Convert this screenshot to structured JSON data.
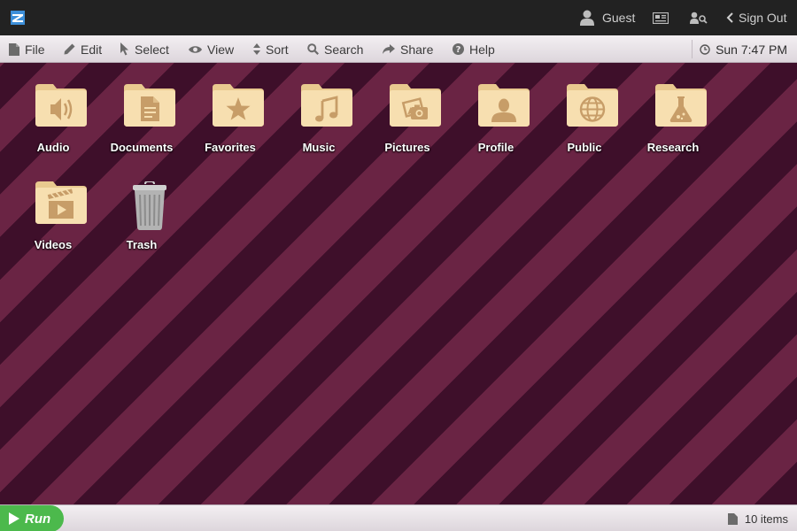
{
  "topbar": {
    "user_label": "Guest",
    "sign_out_label": "Sign Out"
  },
  "menu": {
    "items": [
      {
        "label": "File",
        "icon": "file-icon"
      },
      {
        "label": "Edit",
        "icon": "pencil-icon"
      },
      {
        "label": "Select",
        "icon": "cursor-icon"
      },
      {
        "label": "View",
        "icon": "eye-icon"
      },
      {
        "label": "Sort",
        "icon": "sort-icon"
      },
      {
        "label": "Search",
        "icon": "search-icon"
      },
      {
        "label": "Share",
        "icon": "share-icon"
      },
      {
        "label": "Help",
        "icon": "help-icon"
      }
    ],
    "clock": "Sun 7:47 PM"
  },
  "desktop": {
    "icons": [
      {
        "label": "Audio",
        "icon": "folder-audio-icon"
      },
      {
        "label": "Documents",
        "icon": "folder-documents-icon"
      },
      {
        "label": "Favorites",
        "icon": "folder-favorites-icon"
      },
      {
        "label": "Music",
        "icon": "folder-music-icon"
      },
      {
        "label": "Pictures",
        "icon": "folder-pictures-icon"
      },
      {
        "label": "Profile",
        "icon": "folder-profile-icon"
      },
      {
        "label": "Public",
        "icon": "folder-public-icon"
      },
      {
        "label": "Research",
        "icon": "folder-research-icon"
      },
      {
        "label": "Videos",
        "icon": "folder-videos-icon"
      },
      {
        "label": "Trash",
        "icon": "trash-icon"
      }
    ]
  },
  "bottombar": {
    "run_label": "Run",
    "status": "10 items"
  },
  "colors": {
    "stripe_dark": "#3e0f2a",
    "stripe_light": "#6a2444",
    "folder": "#f7dfb0",
    "run_green": "#4cb94c"
  }
}
